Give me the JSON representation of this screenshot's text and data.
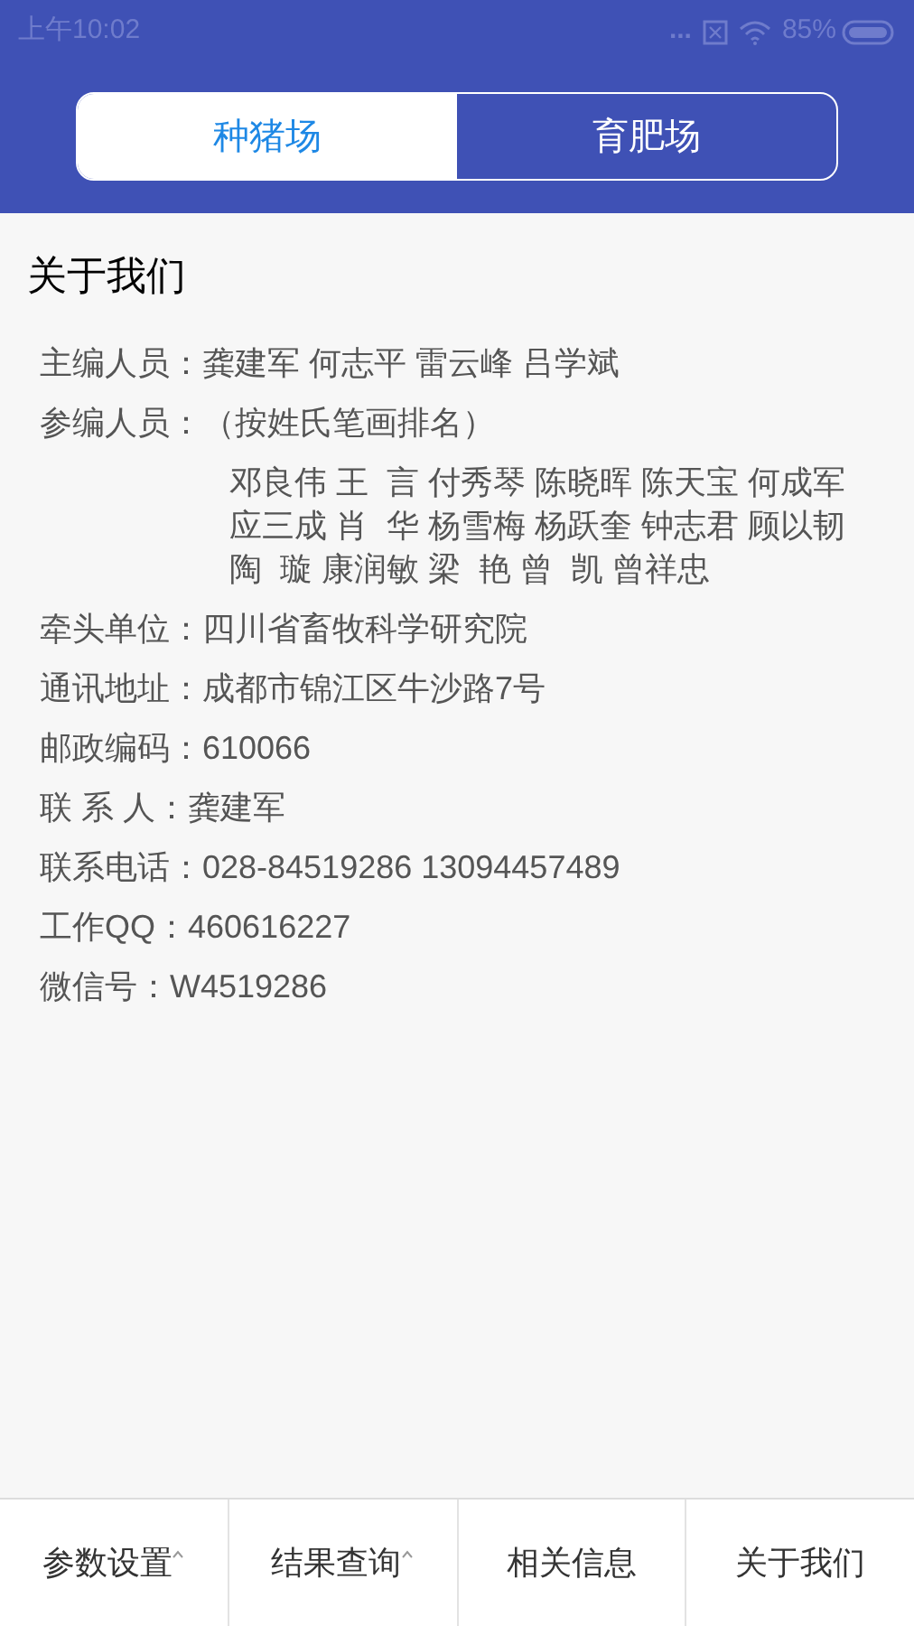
{
  "status_bar": {
    "time": "上午10:02",
    "dots": "...",
    "battery": "85%"
  },
  "tabs": [
    {
      "label": "种猪场",
      "selected": true
    },
    {
      "label": "育肥场",
      "selected": false
    }
  ],
  "page_title": "关于我们",
  "info": [
    {
      "label": "主编人员：",
      "value": "龚建军 何志平 雷云峰 吕学斌"
    },
    {
      "label": "参编人员：",
      "value": "（按姓氏笔画排名）",
      "lines": [
        "邓良伟 王  言 付秀琴 陈晓晖 陈天宝 何成军",
        "应三成 肖  华 杨雪梅 杨跃奎 钟志君 顾以韧",
        "陶  璇 康润敏 梁  艳 曾  凯 曾祥忠"
      ]
    },
    {
      "label": "牵头单位：",
      "value": "四川省畜牧科学研究院"
    },
    {
      "label": "通讯地址：",
      "value": "成都市锦江区牛沙路7号"
    },
    {
      "label": "邮政编码：",
      "value": "610066"
    },
    {
      "label": "联 系 人：",
      "value": "龚建军"
    },
    {
      "label": "联系电话：",
      "value": "028-84519286 13094457489"
    },
    {
      "label": "工作QQ：",
      "value": "460616227"
    },
    {
      "label": "微信号：",
      "value": "W4519286"
    }
  ],
  "bottom_nav": [
    {
      "label": "参数设置",
      "has_menu": true
    },
    {
      "label": "结果查询",
      "has_menu": true
    },
    {
      "label": "相关信息",
      "has_menu": false
    },
    {
      "label": "关于我们",
      "has_menu": false
    }
  ]
}
